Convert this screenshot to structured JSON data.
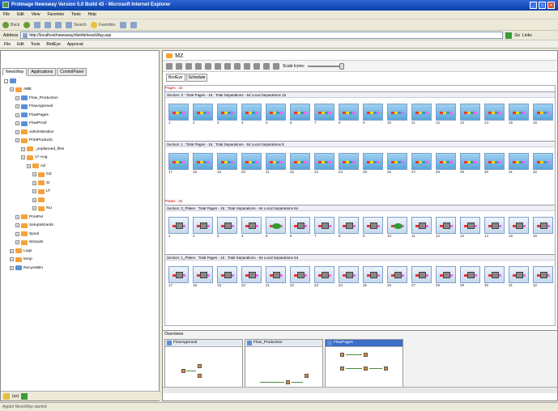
{
  "window": {
    "title": "ProImage Newsway Version 5.0 Build 43 - Microsoft Internet Explorer"
  },
  "menu": [
    "File",
    "Edit",
    "View",
    "Favorites",
    "Tools",
    "Help"
  ],
  "toolbar": {
    "back": "Back",
    "search": "Search",
    "favorites": "Favorites"
  },
  "address": {
    "label": "Address",
    "url": "http://localhost/newsway/distrib/newsWay.asp",
    "go": "Go",
    "links": "Links"
  },
  "app_menu": [
    "File",
    "Edit",
    "Tools",
    "BirdEye",
    "Approval"
  ],
  "left_tabs": [
    "NewsWay",
    "Applications",
    "ControlPanel"
  ],
  "tree": [
    {
      "label": "ABB",
      "indent": 1,
      "type": "orange"
    },
    {
      "label": "Flow_Production",
      "indent": 2,
      "type": "blue"
    },
    {
      "label": "FlowApproval",
      "indent": 2,
      "type": "blue"
    },
    {
      "label": "FlowPages",
      "indent": 2,
      "type": "blue"
    },
    {
      "label": "FlowProof",
      "indent": 2,
      "type": "blue"
    },
    {
      "label": "Administration",
      "indent": 2,
      "type": "orange"
    },
    {
      "label": "PrintProducts",
      "indent": 2,
      "type": "orange"
    },
    {
      "label": "_unplanned_files",
      "indent": 3,
      "type": "orange"
    },
    {
      "label": "17-Aug",
      "indent": 3,
      "type": "orange"
    },
    {
      "label": "AZ",
      "indent": 4,
      "type": "orange"
    },
    {
      "label": "GZ",
      "indent": 5,
      "type": "orange"
    },
    {
      "label": "SI",
      "indent": 5,
      "type": "orange"
    },
    {
      "label": "LT",
      "indent": 5,
      "type": "orange"
    },
    {
      "label": "",
      "indent": 5,
      "type": "orange"
    },
    {
      "label": "NU",
      "indent": 5,
      "type": "orange"
    },
    {
      "label": "ProsPer",
      "indent": 2,
      "type": "orange"
    },
    {
      "label": "SetupWizards",
      "indent": 2,
      "type": "orange"
    },
    {
      "label": "Spool",
      "indent": 2,
      "type": "orange"
    },
    {
      "label": "Wizards",
      "indent": 2,
      "type": "orange"
    },
    {
      "label": "Logs",
      "indent": 1,
      "type": "orange"
    },
    {
      "label": "temp",
      "indent": 1,
      "type": "orange"
    },
    {
      "label": "RecycleBin",
      "indent": 1,
      "type": "blue"
    }
  ],
  "left_status": "(xx)",
  "main": {
    "title": "MZ",
    "scale_label": "Scale Icons:",
    "tabs": [
      "BirdEye",
      "Schedule"
    ],
    "pages_label": "Pages : 32",
    "plates_label": "Plates : 32",
    "sections": [
      {
        "label": "Section: 0 : Total Pages - 16 : Total Separations - 64 Local Separations 16",
        "start": 1,
        "kind": "page"
      },
      {
        "label": "Section: 1 : Total Pages - 16 : Total Separations - 64 Local Separations 8",
        "start": 17,
        "kind": "page"
      },
      {
        "label": "Section: 0_Plates : Total Pages - 16 : Total Separations - 64 Local Separations 64",
        "start": 1,
        "kind": "plate"
      },
      {
        "label": "Section: 1_Plates : Total Pages - 16 : Total Separations - 64 Local Separations 64",
        "start": 17,
        "kind": "plate"
      }
    ]
  },
  "overviews": {
    "title": "Overviews",
    "panes": [
      "FlowApproval",
      "Flow_Production",
      "FlowPages"
    ]
  },
  "statusbar": {
    "text": "Applet NewsWay started"
  }
}
